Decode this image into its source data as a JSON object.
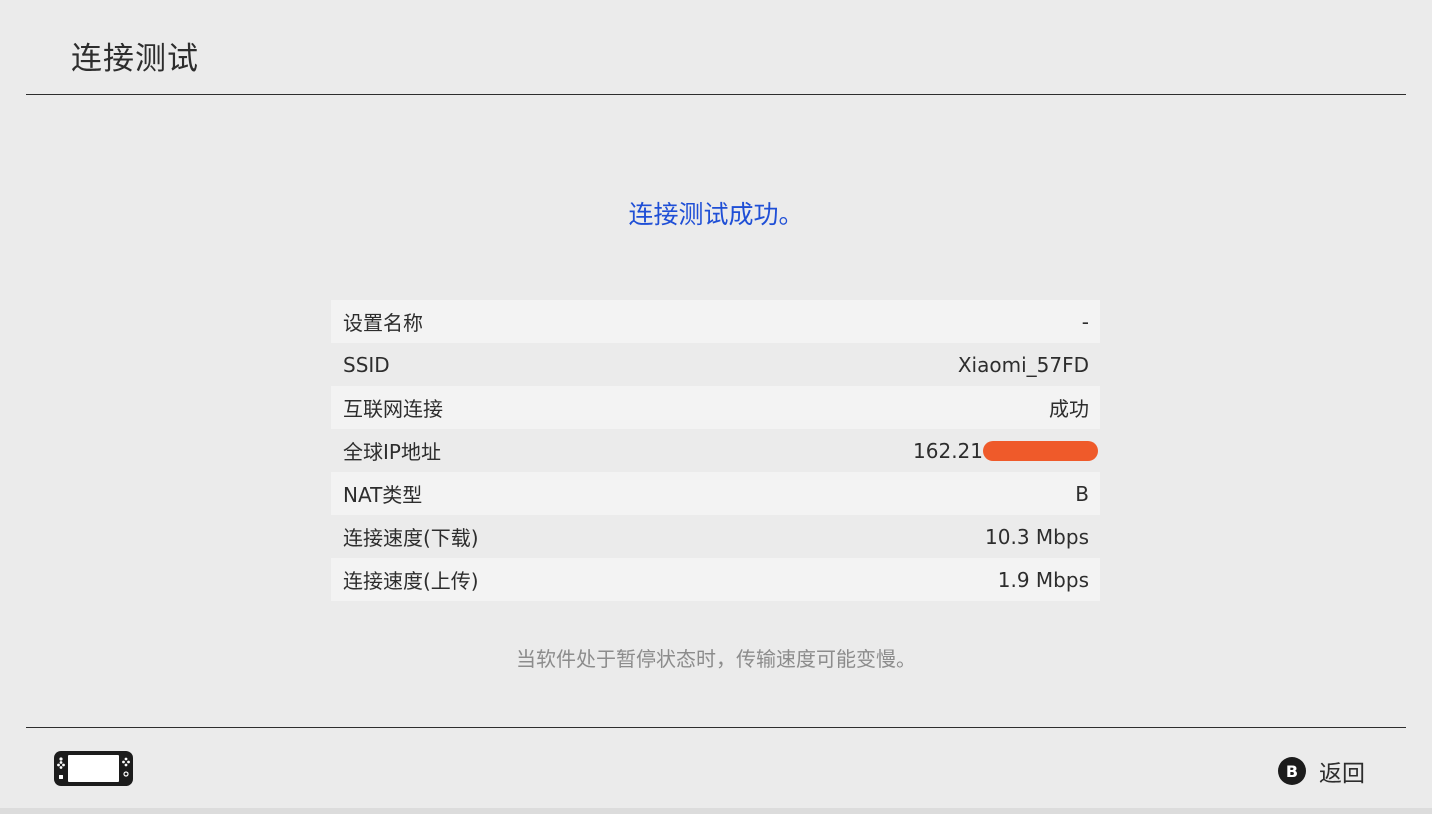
{
  "header": {
    "title": "连接测试"
  },
  "result": {
    "message": "连接测试成功。",
    "message_color": "#1f4fd6"
  },
  "info_rows": [
    {
      "label": "设置名称",
      "value": "-"
    },
    {
      "label": "SSID",
      "value": "Xiaomi_57FD"
    },
    {
      "label": "互联网连接",
      "value": "成功"
    },
    {
      "label": "全球IP地址",
      "value": "162.21",
      "redacted": true,
      "redaction_color": "#ef5a2a"
    },
    {
      "label": "NAT类型",
      "value": "B"
    },
    {
      "label": "连接速度(下载)",
      "value": "10.3 Mbps"
    },
    {
      "label": "连接速度(上传)",
      "value": "1.9 Mbps"
    }
  ],
  "footnote": "当软件处于暂停状态时，传输速度可能变慢。",
  "footer": {
    "console_icon": "handheld-console-icon",
    "back_button": {
      "icon": "b-button-icon",
      "icon_letter": "B",
      "label": "返回"
    }
  }
}
